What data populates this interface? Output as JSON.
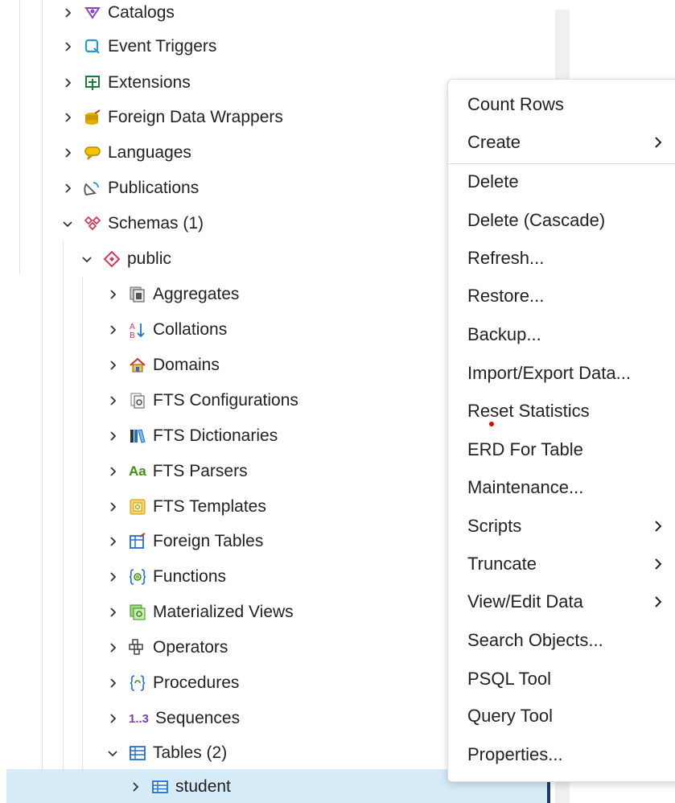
{
  "tree": {
    "items": [
      {
        "label": "Catalogs",
        "icon": "catalogs-icon"
      },
      {
        "label": "Event Triggers",
        "icon": "event-triggers-icon"
      },
      {
        "label": "Extensions",
        "icon": "extensions-icon"
      },
      {
        "label": "Foreign Data Wrappers",
        "icon": "foreign-data-wrappers-icon"
      },
      {
        "label": "Languages",
        "icon": "languages-icon"
      },
      {
        "label": "Publications",
        "icon": "publications-icon"
      },
      {
        "label": "Schemas (1)",
        "icon": "schemas-icon"
      },
      {
        "label": "public",
        "icon": "schema-public-icon"
      },
      {
        "label": "Aggregates",
        "icon": "aggregates-icon"
      },
      {
        "label": "Collations",
        "icon": "collations-icon"
      },
      {
        "label": "Domains",
        "icon": "domains-icon"
      },
      {
        "label": "FTS Configurations",
        "icon": "fts-configurations-icon"
      },
      {
        "label": "FTS Dictionaries",
        "icon": "fts-dictionaries-icon"
      },
      {
        "label": "FTS Parsers",
        "icon": "fts-parsers-icon"
      },
      {
        "label": "FTS Templates",
        "icon": "fts-templates-icon"
      },
      {
        "label": "Foreign Tables",
        "icon": "foreign-tables-icon"
      },
      {
        "label": "Functions",
        "icon": "functions-icon"
      },
      {
        "label": "Materialized Views",
        "icon": "materialized-views-icon"
      },
      {
        "label": "Operators",
        "icon": "operators-icon"
      },
      {
        "label": "Procedures",
        "icon": "procedures-icon"
      },
      {
        "label": "Sequences",
        "icon": "sequences-icon"
      },
      {
        "label": "Tables (2)",
        "icon": "tables-icon"
      },
      {
        "label": "student",
        "icon": "table-icon"
      }
    ]
  },
  "glyphs": {
    "fts_parsers": "Aa",
    "sequences": "1..3"
  },
  "context_menu": {
    "items": [
      {
        "label": "Count Rows",
        "submenu": false
      },
      {
        "label": "Create",
        "submenu": true
      },
      {
        "label": "Delete",
        "submenu": false
      },
      {
        "label": "Delete (Cascade)",
        "submenu": false
      },
      {
        "label": "Refresh...",
        "submenu": false
      },
      {
        "label": "Restore...",
        "submenu": false
      },
      {
        "label": "Backup...",
        "submenu": false
      },
      {
        "label": "Import/Export Data...",
        "submenu": false
      },
      {
        "label": "Reset Statistics",
        "submenu": false
      },
      {
        "label": "ERD For Table",
        "submenu": false
      },
      {
        "label": "Maintenance...",
        "submenu": false
      },
      {
        "label": "Scripts",
        "submenu": true
      },
      {
        "label": "Truncate",
        "submenu": true
      },
      {
        "label": "View/Edit Data",
        "submenu": true
      },
      {
        "label": "Search Objects...",
        "submenu": false
      },
      {
        "label": "PSQL Tool",
        "submenu": false
      },
      {
        "label": "Query Tool",
        "submenu": false
      },
      {
        "label": "Properties...",
        "submenu": false
      }
    ]
  },
  "colors": {
    "selection": "#d6ebf8",
    "selection_edge": "#1b3b66",
    "cursor_dot": "#e00000"
  }
}
